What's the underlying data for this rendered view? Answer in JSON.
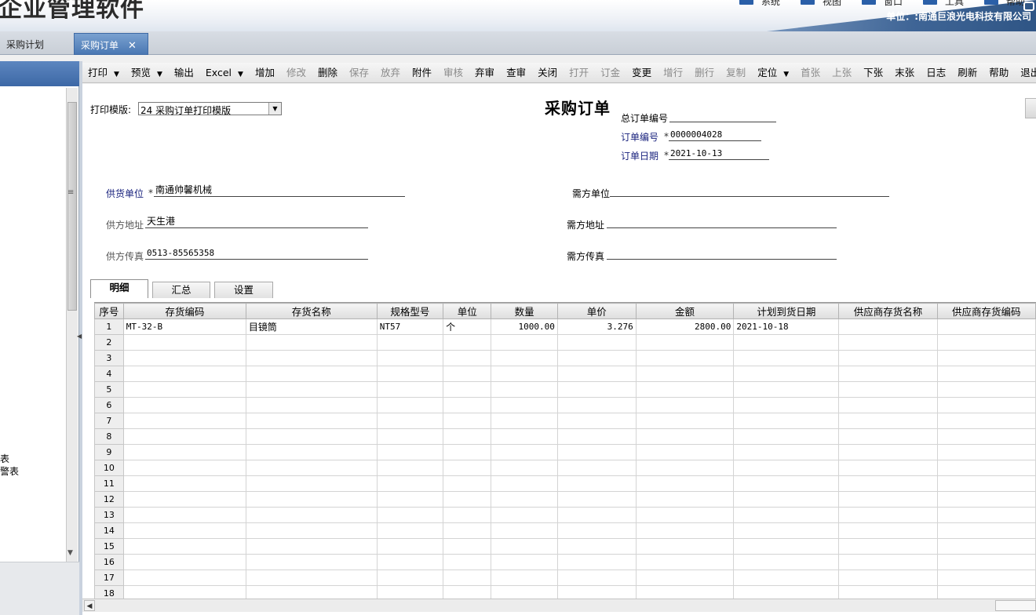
{
  "app": {
    "title": "企业管理软件",
    "company": "单位：:南通巨浪光电科技有限公司"
  },
  "top_menu": [
    "系统",
    "视图",
    "窗口",
    "工具",
    "帮助"
  ],
  "tabs": [
    {
      "label": "采购计划"
    },
    {
      "label": "采购订单",
      "close": "✕"
    }
  ],
  "left_panel": {
    "fragments": [
      "表",
      "警表"
    ]
  },
  "toolbar": {
    "buttons": [
      {
        "label": "打印",
        "dropdown": true,
        "enabled": true
      },
      {
        "label": "预览",
        "dropdown": true,
        "enabled": true
      },
      {
        "label": "输出",
        "enabled": true
      },
      {
        "label": "Excel",
        "dropdown": true,
        "enabled": true
      },
      {
        "label": "增加",
        "enabled": true
      },
      {
        "label": "修改",
        "enabled": false
      },
      {
        "label": "删除",
        "enabled": true
      },
      {
        "label": "保存",
        "enabled": false
      },
      {
        "label": "放弃",
        "enabled": false
      },
      {
        "label": "附件",
        "enabled": true
      },
      {
        "label": "审核",
        "enabled": false
      },
      {
        "label": "弃审",
        "enabled": true
      },
      {
        "label": "查审",
        "enabled": true
      },
      {
        "label": "关闭",
        "enabled": true
      },
      {
        "label": "打开",
        "enabled": false
      },
      {
        "label": "订金",
        "enabled": false
      },
      {
        "label": "变更",
        "enabled": true
      },
      {
        "label": "增行",
        "enabled": false
      },
      {
        "label": "删行",
        "enabled": false
      },
      {
        "label": "复制",
        "enabled": false
      },
      {
        "label": "定位",
        "dropdown": true,
        "enabled": true
      },
      {
        "label": "首张",
        "enabled": false
      },
      {
        "label": "上张",
        "enabled": false
      },
      {
        "label": "下张",
        "enabled": true
      },
      {
        "label": "末张",
        "enabled": true
      },
      {
        "label": "日志",
        "enabled": true
      },
      {
        "label": "刷新",
        "enabled": true
      },
      {
        "label": "帮助",
        "enabled": true
      },
      {
        "label": "退出",
        "enabled": true
      }
    ]
  },
  "form": {
    "title": "采购订单",
    "print_template_label": "打印模版:",
    "print_template_value": "24 采购订单打印模版",
    "required_mark": "*",
    "total_order_no_label": "总订单编号",
    "total_order_no": "",
    "order_no_label": "订单编号",
    "order_no": "0000004028",
    "order_date_label": "订单日期",
    "order_date": "2021-10-13",
    "supplier_label": "供货单位",
    "supplier": "南通帅馨机械",
    "supplier_address_label": "供方地址",
    "supplier_address": "天生港",
    "supplier_fax_label": "供方传真",
    "supplier_fax": "0513-85565358",
    "buyer_label": "需方单位",
    "buyer": "",
    "buyer_address_label": "需方地址",
    "buyer_address": "",
    "buyer_fax_label": "需方传真",
    "buyer_fax": ""
  },
  "detail_tabs": [
    "明细",
    "汇总",
    "设置"
  ],
  "grid": {
    "columns": [
      "序号",
      "存货编码",
      "存货名称",
      "规格型号",
      "单位",
      "数量",
      "单价",
      "金额",
      "计划到货日期",
      "供应商存货名称",
      "供应商存货编码"
    ],
    "rows": [
      [
        "1",
        "MT-32-B",
        "目镜筒",
        "NT57",
        "个",
        "1000.00",
        "3.276",
        "2800.00",
        "2021-10-18",
        "",
        ""
      ],
      [
        "2",
        "",
        "",
        "",
        "",
        "",
        "",
        "",
        "",
        "",
        ""
      ],
      [
        "3",
        "",
        "",
        "",
        "",
        "",
        "",
        "",
        "",
        "",
        ""
      ],
      [
        "4",
        "",
        "",
        "",
        "",
        "",
        "",
        "",
        "",
        "",
        ""
      ],
      [
        "5",
        "",
        "",
        "",
        "",
        "",
        "",
        "",
        "",
        "",
        ""
      ],
      [
        "6",
        "",
        "",
        "",
        "",
        "",
        "",
        "",
        "",
        "",
        ""
      ],
      [
        "7",
        "",
        "",
        "",
        "",
        "",
        "",
        "",
        "",
        "",
        ""
      ],
      [
        "8",
        "",
        "",
        "",
        "",
        "",
        "",
        "",
        "",
        "",
        ""
      ],
      [
        "9",
        "",
        "",
        "",
        "",
        "",
        "",
        "",
        "",
        "",
        ""
      ],
      [
        "10",
        "",
        "",
        "",
        "",
        "",
        "",
        "",
        "",
        "",
        ""
      ],
      [
        "11",
        "",
        "",
        "",
        "",
        "",
        "",
        "",
        "",
        "",
        ""
      ],
      [
        "12",
        "",
        "",
        "",
        "",
        "",
        "",
        "",
        "",
        "",
        ""
      ],
      [
        "13",
        "",
        "",
        "",
        "",
        "",
        "",
        "",
        "",
        "",
        ""
      ],
      [
        "14",
        "",
        "",
        "",
        "",
        "",
        "",
        "",
        "",
        "",
        ""
      ],
      [
        "15",
        "",
        "",
        "",
        "",
        "",
        "",
        "",
        "",
        "",
        ""
      ],
      [
        "16",
        "",
        "",
        "",
        "",
        "",
        "",
        "",
        "",
        "",
        ""
      ],
      [
        "17",
        "",
        "",
        "",
        "",
        "",
        "",
        "",
        "",
        "",
        ""
      ],
      [
        "18",
        "",
        "",
        "",
        "",
        "",
        "",
        "",
        "",
        "",
        ""
      ]
    ]
  }
}
